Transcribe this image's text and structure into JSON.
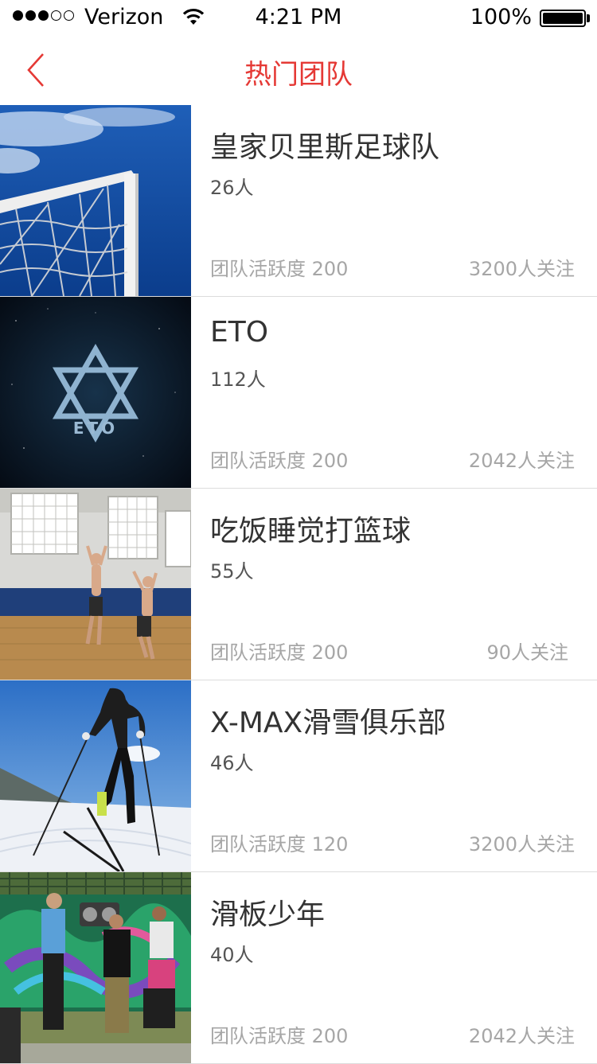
{
  "status_bar": {
    "carrier": "Verizon",
    "time": "4:21 PM",
    "battery": "100%"
  },
  "nav": {
    "back_icon": "chevron-left-icon",
    "title": "热门团队",
    "accent_color": "#e53935"
  },
  "teams": [
    {
      "name": "皇家贝里斯足球队",
      "members": "26人",
      "activity": "团队活跃度 200",
      "followers": "3200人关注",
      "image": "soccer-goal"
    },
    {
      "name": "ETO",
      "members": "112人",
      "activity": "团队活跃度 200",
      "followers": "2042人关注",
      "image": "eto-logo",
      "logo_text": "ETO"
    },
    {
      "name": "吃饭睡觉打篮球",
      "members": "55人",
      "activity": "团队活跃度 200",
      "followers": "90人关注",
      "image": "basketball"
    },
    {
      "name": "X-MAX滑雪俱乐部",
      "members": "46人",
      "activity": "团队活跃度 120",
      "followers": "3200人关注",
      "image": "skier"
    },
    {
      "name": "滑板少年",
      "members": "40人",
      "activity": "团队活跃度 200",
      "followers": "2042人关注",
      "image": "skate-crew"
    }
  ]
}
